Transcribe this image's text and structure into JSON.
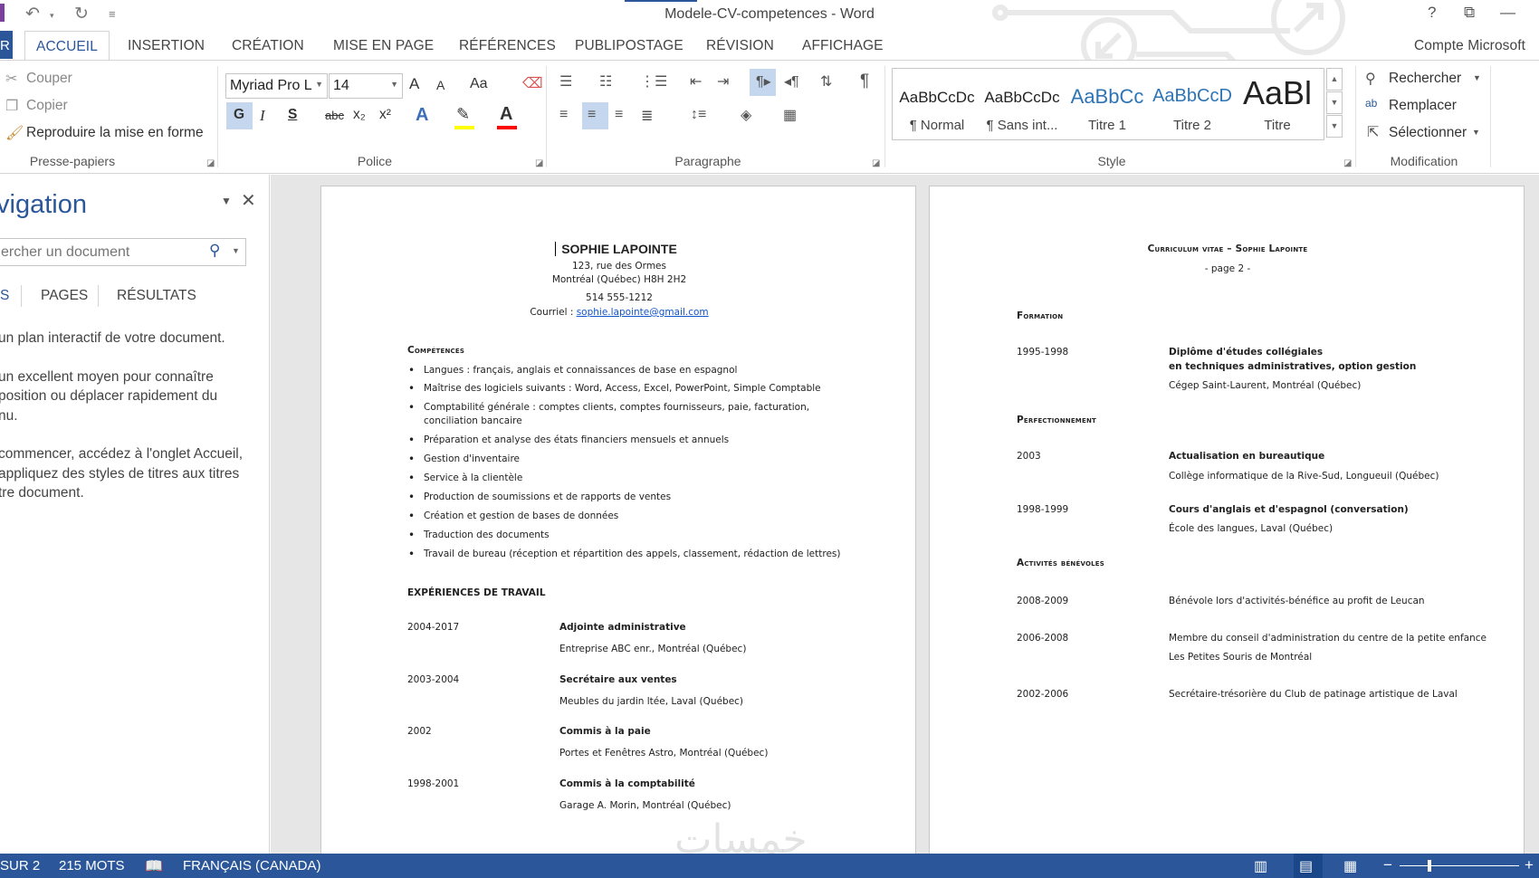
{
  "titlebar": {
    "title": "Modele-CV-competences - Word",
    "help": "?",
    "restore": "⧉",
    "minimize": "—"
  },
  "tabs": {
    "file": "R",
    "items": [
      "ACCUEIL",
      "INSERTION",
      "CRÉATION",
      "MISE EN PAGE",
      "RÉFÉRENCES",
      "PUBLIPOSTAGE",
      "RÉVISION",
      "AFFICHAGE"
    ],
    "account": "Compte Microsoft"
  },
  "ribbon": {
    "clipboard": {
      "cut": "Couper",
      "copy": "Copier",
      "format_painter": "Reproduire la mise en forme",
      "label": "Presse-papiers"
    },
    "font": {
      "font_name": "Myriad Pro L",
      "font_size": "14",
      "label": "Police",
      "bold": "G",
      "italic": "I",
      "underline": "S",
      "strike": "abc",
      "subscript": "x₂",
      "superscript": "x²",
      "grow": "A",
      "shrink": "A",
      "case": "Aa",
      "highlight_color": "#ffff00",
      "font_color": "#ff0000"
    },
    "paragraph": {
      "label": "Paragraphe",
      "pilcrow": "¶"
    },
    "styles": {
      "label": "Style",
      "items": [
        {
          "sample": "AaBbCcDc",
          "name": "¶ Normal"
        },
        {
          "sample": "AaBbCcDc",
          "name": "¶ Sans int..."
        },
        {
          "sample": "AaBbCc",
          "name": "Titre 1"
        },
        {
          "sample": "AaBbCcD",
          "name": "Titre 2"
        },
        {
          "sample": "AaBl",
          "name": "Titre"
        }
      ]
    },
    "editing": {
      "label": "Modification",
      "find": "Rechercher",
      "replace": "Remplacer",
      "select": "Sélectionner"
    }
  },
  "navpane": {
    "title": "vigation",
    "search_placeholder": "ercher un document",
    "tabs": [
      "S",
      "PAGES",
      "RÉSULTATS"
    ],
    "help": [
      "un plan interactif de votre document.",
      "un excellent moyen pour connaître\nposition ou déplacer rapidement du\nnu.",
      "commencer, accédez à l'onglet Accueil,\nappliquez des styles de titres aux titres\ntre document."
    ]
  },
  "page1": {
    "name": "SOPHIE LAPOINTE",
    "address1": "123, rue des Ormes",
    "address2": "Montréal (Québec)  H8H 2H2",
    "phone": "514 555-1212",
    "email_label": "Courriel : ",
    "email": "sophie.lapointe@gmail.com",
    "skills_heading": "Compétences",
    "skills": [
      "Langues : français, anglais et connaissances de base en espagnol",
      "Maîtrise des logiciels suivants : Word, Access, Excel, PowerPoint, Simple Comptable",
      "Comptabilité générale : comptes clients, comptes fournisseurs, paie, facturation,",
      "Préparation et analyse des états financiers mensuels et annuels",
      "Gestion d'inventaire",
      "Service à la clientèle",
      "Production de soumissions et de rapports de ventes",
      "Création et gestion de bases de données",
      "Traduction des documents",
      "Travail de bureau (réception et répartition des appels, classement, rédaction de lettres)"
    ],
    "skills_cont": "conciliation bancaire",
    "experience_heading": "EXPÉRIENCES DE TRAVAIL",
    "jobs": [
      {
        "years": "2004-2017",
        "title": "Adjointe administrative",
        "place": "Entreprise ABC enr., Montréal (Québec)"
      },
      {
        "years": "2003-2004",
        "title": "Secrétaire aux ventes",
        "place": "Meubles du jardin ltée, Laval (Québec)"
      },
      {
        "years": "2002",
        "title": "Commis à la paie",
        "place": "Portes et Fenêtres Astro, Montréal (Québec)"
      },
      {
        "years": "1998-2001",
        "title": "Commis à la comptabilité",
        "place": "Garage A. Morin, Montréal (Québec)"
      }
    ]
  },
  "page2": {
    "header": "Curriculum vitae – Sophie Lapointe",
    "page": "- page 2 -",
    "formation_heading": "Formation",
    "formation": {
      "years": "1995-1998",
      "title1": "Diplôme d'études collégiales",
      "title2": "en techniques administratives, option gestion",
      "place": "Cégep Saint-Laurent, Montréal (Québec)"
    },
    "perf_heading": "Perfectionnement",
    "perf": [
      {
        "years": "2003",
        "title": "Actualisation en bureautique",
        "place": "Collège informatique de la Rive-Sud, Longueuil (Québec)"
      },
      {
        "years": "1998-1999",
        "title": "Cours d'anglais et d'espagnol (conversation)",
        "place": "École des langues, Laval (Québec)"
      }
    ],
    "volunteer_heading": "Activités bénévoles",
    "volunteer": [
      {
        "years": "2008-2009",
        "line1": "Bénévole lors d'activités-bénéfice au profit de Leucan",
        "line2": ""
      },
      {
        "years": "2006-2008",
        "line1": "Membre du conseil d'administration du centre de la petite enfance",
        "line2": "Les Petites Souris de Montréal"
      },
      {
        "years": "2002-2006",
        "line1": "Secrétaire-trésorière du Club de patinage artistique de Laval",
        "line2": ""
      }
    ]
  },
  "statusbar": {
    "page": "SUR 2",
    "words": "215 MOTS",
    "language": "FRANÇAIS (CANADA)",
    "zoom_minus": "−",
    "zoom_plus": "+"
  },
  "watermark": "خمسات",
  "colors": {
    "accent": "#2b579a"
  }
}
